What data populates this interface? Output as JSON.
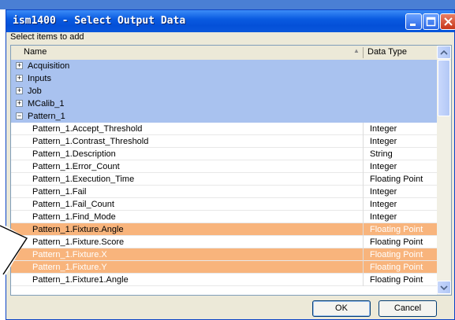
{
  "window": {
    "title": "ism1400 - Select Output Data"
  },
  "subtitle": "Select items to add",
  "columns": {
    "name": "Name",
    "type": "Data Type"
  },
  "groups": [
    {
      "label": "Acquisition",
      "toggle": "+"
    },
    {
      "label": "Inputs",
      "toggle": "+"
    },
    {
      "label": "Job",
      "toggle": "+"
    },
    {
      "label": "MCalib_1",
      "toggle": "+"
    },
    {
      "label": "Pattern_1",
      "toggle": "−"
    }
  ],
  "items": [
    {
      "name": "Pattern_1.Accept_Threshold",
      "type": "Integer"
    },
    {
      "name": "Pattern_1.Contrast_Threshold",
      "type": "Integer"
    },
    {
      "name": "Pattern_1.Description",
      "type": "String"
    },
    {
      "name": "Pattern_1.Error_Count",
      "type": "Integer"
    },
    {
      "name": "Pattern_1.Execution_Time",
      "type": "Floating Point"
    },
    {
      "name": "Pattern_1.Fail",
      "type": "Integer"
    },
    {
      "name": "Pattern_1.Fail_Count",
      "type": "Integer"
    },
    {
      "name": "Pattern_1.Find_Mode",
      "type": "Integer"
    },
    {
      "name": "Pattern_1.Fixture.Angle",
      "type": "Floating Point"
    },
    {
      "name": "Pattern_1.Fixture.Score",
      "type": "Floating Point"
    },
    {
      "name": "Pattern_1.Fixture.X",
      "type": "Floating Point"
    },
    {
      "name": "Pattern_1.Fixture.Y",
      "type": "Floating Point"
    },
    {
      "name": "Pattern_1.Fixture1.Angle",
      "type": "Floating Point"
    }
  ],
  "buttons": {
    "ok": "OK",
    "cancel": "Cancel"
  },
  "colors": {
    "selection": "#f8b47c",
    "group_row": "#a9c2ef",
    "title_bar": "#0a5be0"
  }
}
